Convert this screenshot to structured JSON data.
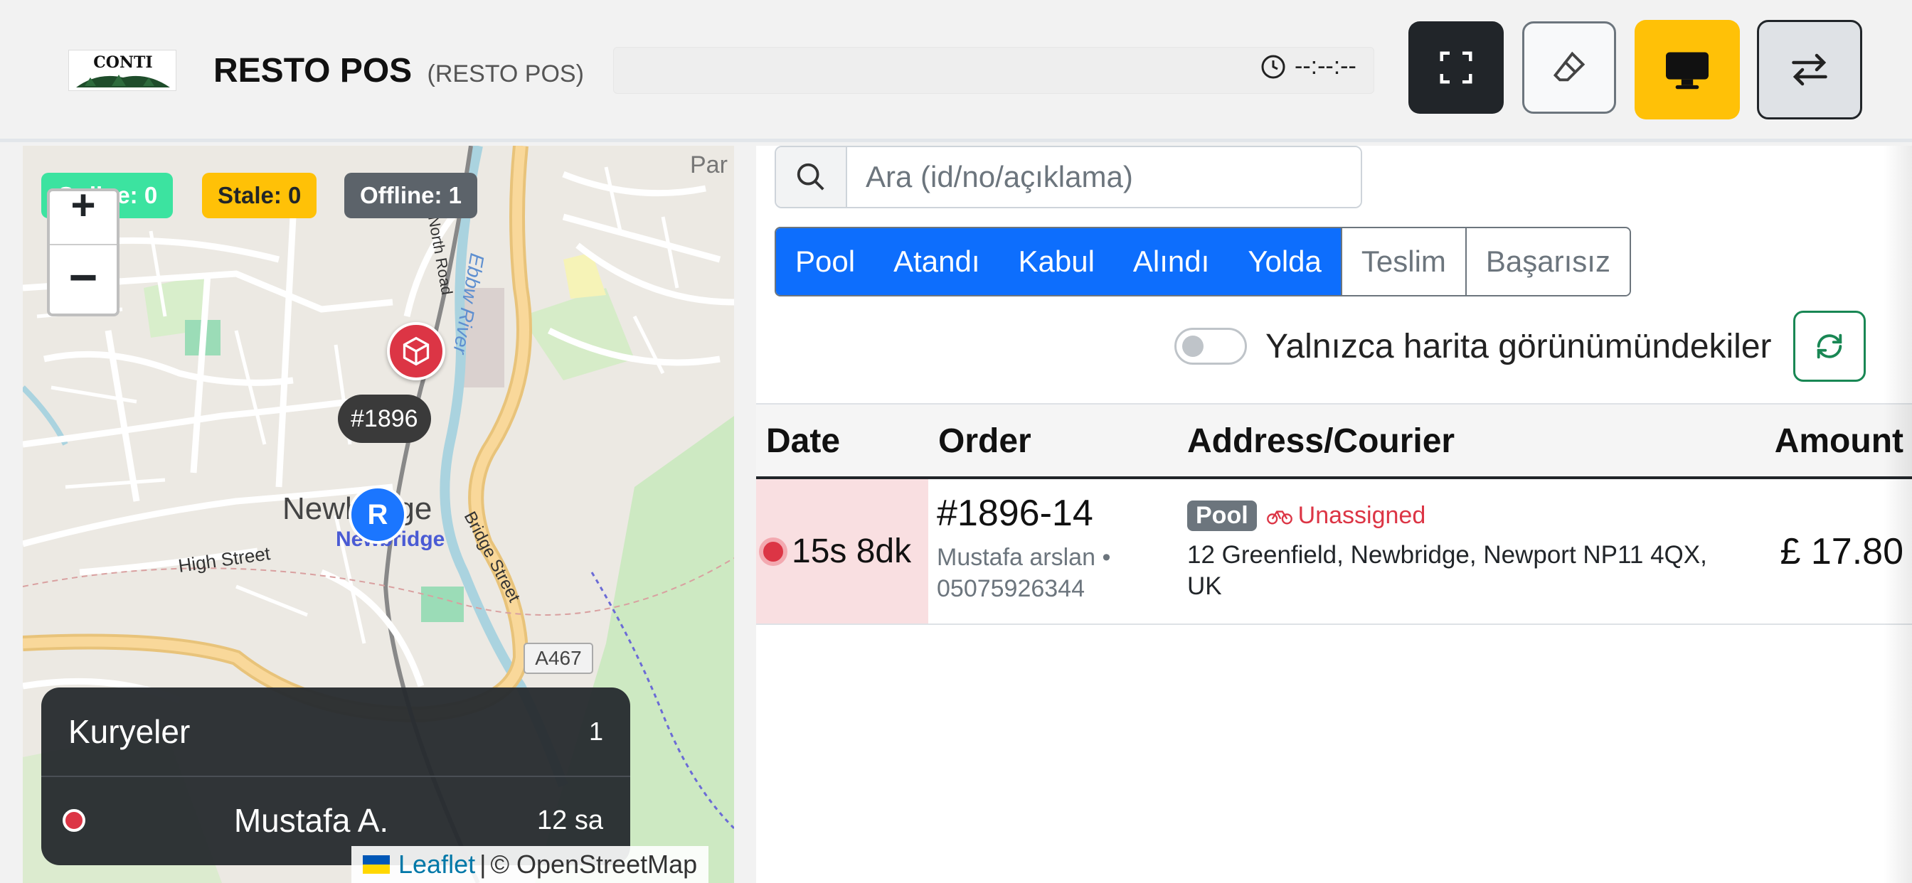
{
  "header": {
    "logo_text": "CONTI",
    "title": "RESTO POS",
    "subtitle": "(RESTO POS)",
    "clock": "--:--:--"
  },
  "map": {
    "status": {
      "online": "Online: 0",
      "stale": "Stale: 0",
      "offline": "Offline: 1"
    },
    "zoom_in": "+",
    "zoom_out": "−",
    "order_label": "#1896",
    "restaurant_marker": "R",
    "place_labels": {
      "town": "Newbridge",
      "town_sub": "Newbridge",
      "high_street": "High Street",
      "bridge_street": "Bridge Street",
      "north_road": "North Road",
      "river": "Ebbw River",
      "road_a467": "A467",
      "park": "Par"
    },
    "couriers": {
      "title": "Kuryeler",
      "count": "1",
      "items": [
        {
          "name": "Mustafa A.",
          "since": "12 sa",
          "status_color": "#dc3545"
        }
      ]
    },
    "attribution": {
      "leaflet": "Leaflet",
      "separator": "|",
      "osm": "© OpenStreetMap"
    }
  },
  "orders": {
    "search_placeholder": "Ara (id/no/açıklama)",
    "tabs": [
      {
        "label": "Pool",
        "active": true
      },
      {
        "label": "Atandı",
        "active": true
      },
      {
        "label": "Kabul",
        "active": true
      },
      {
        "label": "Alındı",
        "active": true
      },
      {
        "label": "Yolda",
        "active": true
      },
      {
        "label": "Teslim",
        "active": false
      },
      {
        "label": "Başarısız",
        "active": false
      }
    ],
    "only_map_view_label": "Yalnızca harita görünümündekiler",
    "columns": {
      "date": "Date",
      "order": "Order",
      "address": "Address/Courier",
      "amount": "Amount"
    },
    "rows": [
      {
        "date": "15s 8dk",
        "order_no": "#1896-14",
        "customer": "Mustafa arslan •",
        "phone": "05075926344",
        "badge": "Pool",
        "courier": "Unassigned",
        "address": "12 Greenfield, Newbridge, Newport NP11 4QX, UK",
        "amount": "£ 17.80"
      }
    ]
  },
  "colors": {
    "primary": "#0d6efd",
    "danger": "#dc3545",
    "warning": "#ffc107",
    "success": "#198754",
    "dark": "#212529"
  }
}
